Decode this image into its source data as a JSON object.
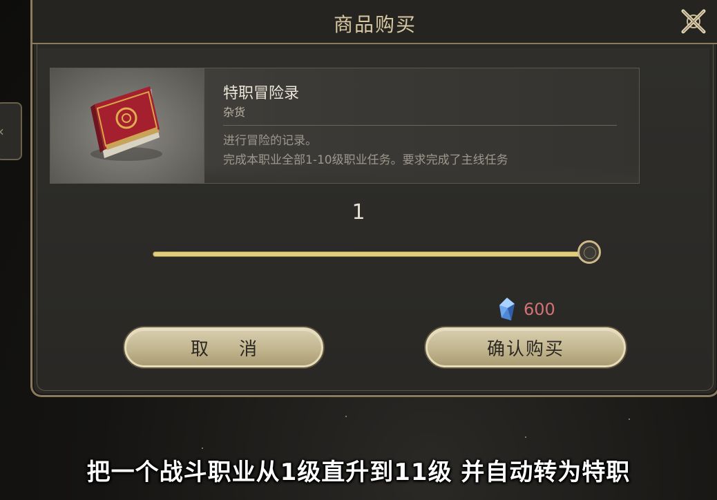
{
  "dialog": {
    "title": "商品购买"
  },
  "item": {
    "name": "特职冒险录",
    "category": "杂货",
    "description_line1": "进行冒险的记录。",
    "description_line2": "完成本职业全部1-10级职业任务。要求完成了主线任务"
  },
  "purchase": {
    "quantity": "1",
    "quantity_slider_fraction": 1.0,
    "price": "600",
    "price_currency_icon": "blue-crystal-icon"
  },
  "buttons": {
    "cancel": "取 消",
    "confirm": "确认购买"
  },
  "caption": {
    "text": "把一个战斗职业从1级直升到11级 并自动转为特职"
  },
  "colors": {
    "gold_border": "#8a7b5c",
    "slider_fill": "#e1cf7c",
    "price_text": "#d27276",
    "button_face": "#c2b68f"
  }
}
